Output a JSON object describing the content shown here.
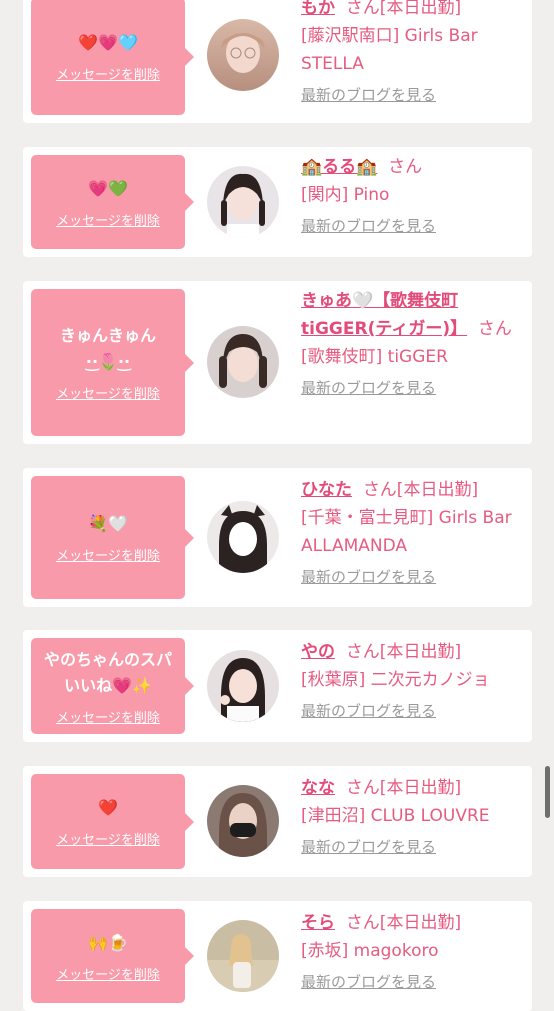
{
  "delete_label": "メッセージを削除",
  "blog_label": "最新のブログを見る",
  "cards": [
    {
      "message": "❤️💗🩵",
      "name": "もか",
      "suffix": "さん[本日出勤]",
      "shop": "[藤沢駅南口] Girls Bar STELLA"
    },
    {
      "message": "💗💚",
      "name": "🏫るる🏫",
      "suffix": "さん",
      "shop": "[関内] Pino"
    },
    {
      "message": "きゅんきゅん\n·͜·🌷·͜·",
      "name": "きゅあ🤍【歌舞伎町tiGGER(ティガー)】",
      "suffix": "さん",
      "shop": "[歌舞伎町] tiGGER"
    },
    {
      "message": "💐🤍",
      "name": "ひなた",
      "suffix": "さん[本日出勤]",
      "shop": "[千葉・富士見町] Girls Bar ALLAMANDA"
    },
    {
      "message": "やのちゃんのスパいいね💗✨",
      "name": "やの",
      "suffix": "さん[本日出勤]",
      "shop": "[秋葉原] 二次元カノジョ"
    },
    {
      "message": "❤️",
      "name": "なな",
      "suffix": "さん[本日出勤]",
      "shop": "[津田沼] CLUB LOUVRE"
    },
    {
      "message": "🙌🍺",
      "name": "そら",
      "suffix": "さん[本日出勤]",
      "shop": "[赤坂] magokoro"
    }
  ]
}
